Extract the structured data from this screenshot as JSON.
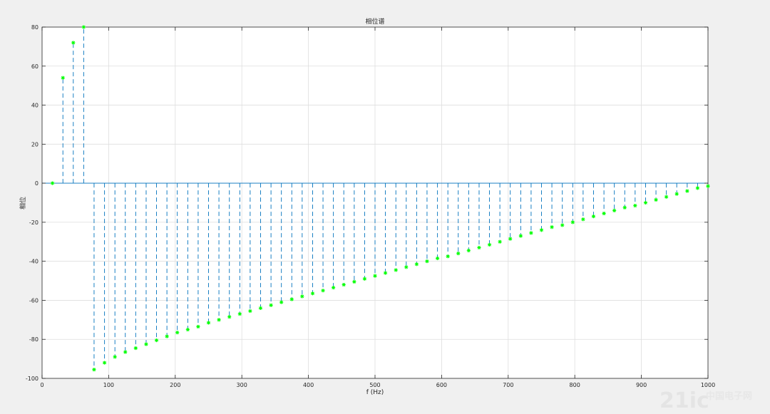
{
  "chart_data": {
    "type": "stem",
    "title": "相位谱",
    "xlabel": "f (Hz)",
    "ylabel": "相位",
    "xlim": [
      0,
      1000
    ],
    "ylim": [
      -100,
      80
    ],
    "xticks": [
      "0",
      "100",
      "200",
      "300",
      "400",
      "500",
      "600",
      "700",
      "800",
      "900",
      "1000"
    ],
    "yticks": [
      "80",
      "60",
      "40",
      "20",
      "0",
      "-20",
      "-40",
      "-60",
      "-80",
      "-100"
    ],
    "grid": true,
    "marker": "*",
    "marker_color": "#00ff00",
    "stem_color": "#0072bd",
    "stem_style": "dashed",
    "x": [
      15.6,
      31.3,
      46.9,
      62.5,
      78.1,
      93.8,
      109.4,
      125.0,
      140.6,
      156.3,
      171.9,
      187.5,
      203.1,
      218.8,
      234.4,
      250.0,
      265.6,
      281.3,
      296.9,
      312.5,
      328.1,
      343.8,
      359.4,
      375.0,
      390.6,
      406.3,
      421.9,
      437.5,
      453.1,
      468.8,
      484.4,
      500.0,
      515.6,
      531.3,
      546.9,
      562.5,
      578.1,
      593.8,
      609.4,
      625.0,
      640.6,
      656.3,
      671.9,
      687.5,
      703.1,
      718.8,
      734.4,
      750.0,
      765.6,
      781.3,
      796.9,
      812.5,
      828.1,
      843.8,
      859.4,
      875.0,
      890.6,
      906.3,
      921.9,
      937.5,
      953.1,
      968.8,
      984.4,
      1000.0
    ],
    "values": [
      0,
      54,
      72,
      80,
      -95.5,
      -92,
      -89,
      -86.5,
      -84.5,
      -82.5,
      -80.5,
      -78.5,
      -76.5,
      -75,
      -73.5,
      -71.5,
      -70,
      -68.5,
      -67,
      -65.5,
      -64,
      -62.5,
      -61,
      -59.5,
      -58,
      -56.5,
      -55,
      -53.5,
      -52,
      -50.5,
      -49,
      -47.5,
      -46,
      -44.5,
      -43,
      -41.5,
      -40,
      -38.5,
      -37.5,
      -36,
      -34.5,
      -33,
      -31.5,
      -30,
      -28.5,
      -27,
      -25.5,
      -24,
      -22.5,
      -21.5,
      -20,
      -18.5,
      -17,
      -15.5,
      -14,
      -12.5,
      -11.5,
      -10,
      -8.5,
      -7,
      -5.5,
      -4,
      -2.5,
      -1.5
    ]
  },
  "watermark": {
    "text": "21ic",
    "subtext": "中国电子网"
  }
}
